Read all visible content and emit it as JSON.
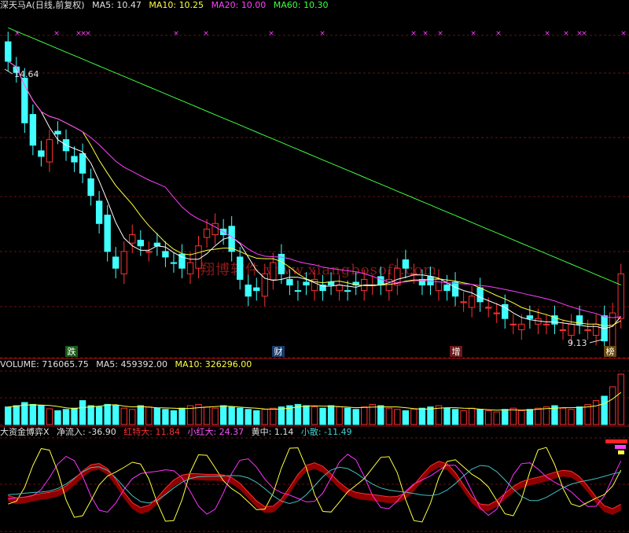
{
  "header": {
    "title": "深天马A(日线,前复权)",
    "ma5_label": "MA5:",
    "ma5_value": "10.47",
    "ma10_label": "MA10:",
    "ma10_value": "10.25",
    "ma20_label": "MA20:",
    "ma20_value": "10.00",
    "ma60_label": "MA60:",
    "ma60_value": "10.30"
  },
  "volume_header": {
    "volume_label": "VOLUME:",
    "volume_value": "716065.75",
    "ma5_label": "MA5:",
    "ma5_value": "459392.00",
    "ma10_label": "MA10:",
    "ma10_value": "326296.00"
  },
  "indicator_header": {
    "name": "大资金博弈X",
    "net_label": "净流入:",
    "net_value": "-36.90",
    "big_label": "红特大:",
    "big_value": "11.84",
    "small_red_label": "小红大:",
    "small_red_value": "24.37",
    "mid_label": "黄中:",
    "mid_value": "1.14",
    "retail_label": "小散:",
    "retail_value": "-11.49"
  },
  "annotations": {
    "high": "14.64",
    "low": "9.13",
    "markers": [
      "跌",
      "财",
      "增",
      "榜"
    ]
  },
  "watermark": "翔博软件 www.xiangbosoft.com",
  "colors": {
    "up": "#ff3030",
    "down": "#40ffff",
    "ma5": "#ffffff",
    "ma10": "#ffff40",
    "ma20": "#ff40ff",
    "ma60": "#40ff40",
    "grid": "#6a1010",
    "retail": "#40c0c0"
  },
  "chart_data": {
    "type": "candlestick",
    "ylim": [
      9.0,
      15.2
    ],
    "close": [
      14.3,
      14.1,
      13.2,
      12.8,
      12.6,
      12.9,
      13.0,
      12.7,
      12.5,
      12.3,
      11.9,
      11.4,
      10.9,
      10.6,
      10.9,
      11.2,
      11.0,
      10.9,
      11.0,
      10.8,
      10.7,
      10.6,
      10.7,
      11.0,
      11.3,
      11.4,
      11.2,
      10.9,
      10.4,
      10.1,
      10.2,
      10.5,
      10.7,
      10.5,
      10.3,
      10.2,
      10.3,
      10.4,
      10.2,
      10.3,
      10.3,
      10.2,
      10.3,
      10.4,
      10.3,
      10.3,
      10.4,
      10.6,
      10.6,
      10.5,
      10.3,
      10.3,
      10.4,
      10.2,
      10.1,
      10.0,
      10.1,
      10.0,
      9.9,
      9.8,
      9.7,
      9.6,
      9.6,
      9.7,
      9.7,
      9.6,
      9.6,
      9.5,
      9.6,
      9.6,
      9.5,
      9.6,
      9.3,
      9.8,
      10.5
    ],
    "volume": [
      28,
      30,
      35,
      32,
      30,
      25,
      22,
      24,
      26,
      38,
      30,
      28,
      32,
      30,
      26,
      24,
      30,
      28,
      26,
      24,
      22,
      26,
      30,
      32,
      28,
      26,
      30,
      28,
      26,
      24,
      22,
      24,
      26,
      28,
      30,
      32,
      30,
      28,
      26,
      30,
      28,
      26,
      24,
      28,
      32,
      30,
      26,
      24,
      22,
      24,
      26,
      28,
      30,
      26,
      24,
      22,
      26,
      24,
      22,
      20,
      24,
      26,
      22,
      24,
      26,
      28,
      30,
      26,
      24,
      28,
      32,
      38,
      45,
      60,
      80
    ],
    "indicator_series": [
      "净流入",
      "红特大",
      "小红大",
      "黄中",
      "小散"
    ]
  }
}
